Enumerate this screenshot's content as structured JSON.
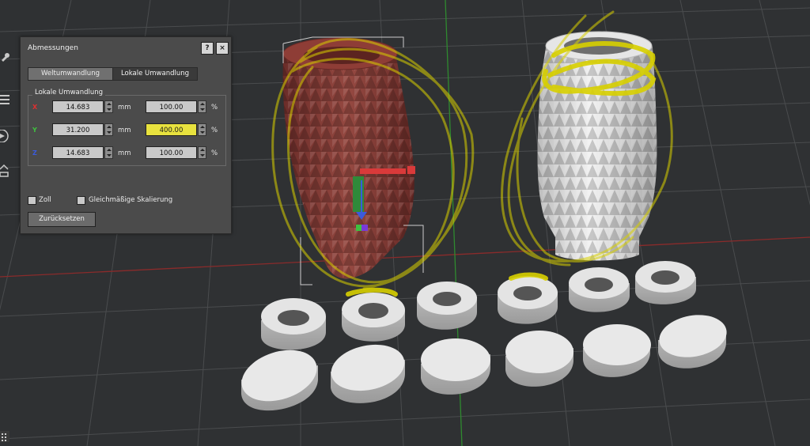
{
  "panel": {
    "title": "Abmessungen",
    "help_button": "?",
    "close_button": "×",
    "tabs": [
      {
        "label": "Weltumwandlung",
        "active": false
      },
      {
        "label": "Lokale Umwandlung",
        "active": true
      }
    ],
    "group_title": "Lokale Umwandlung",
    "rows": [
      {
        "axis": "X",
        "axis_color": "#e03030",
        "size": "14.683",
        "size_unit": "mm",
        "percent": "100.00",
        "percent_unit": "%",
        "highlighted": false
      },
      {
        "axis": "Y",
        "axis_color": "#3fc23f",
        "size": "31.200",
        "size_unit": "mm",
        "percent": "400.00",
        "percent_unit": "%",
        "highlighted": true
      },
      {
        "axis": "Z",
        "axis_color": "#3b5bdc",
        "size": "14.683",
        "size_unit": "mm",
        "percent": "100.00",
        "percent_unit": "%",
        "highlighted": false
      }
    ],
    "checkbox_inch_label": "Zoll",
    "checkbox_inch_checked": false,
    "checkbox_uniform_label": "Gleichmäßige Skalierung",
    "checkbox_uniform_checked": false,
    "reset_button": "Zurücksetzen"
  },
  "viewport": {
    "background": "#2f3133",
    "selected_object_color": "#8a3a34",
    "model_color": "#d9d9d9",
    "annotation_color": "#d8d000"
  }
}
